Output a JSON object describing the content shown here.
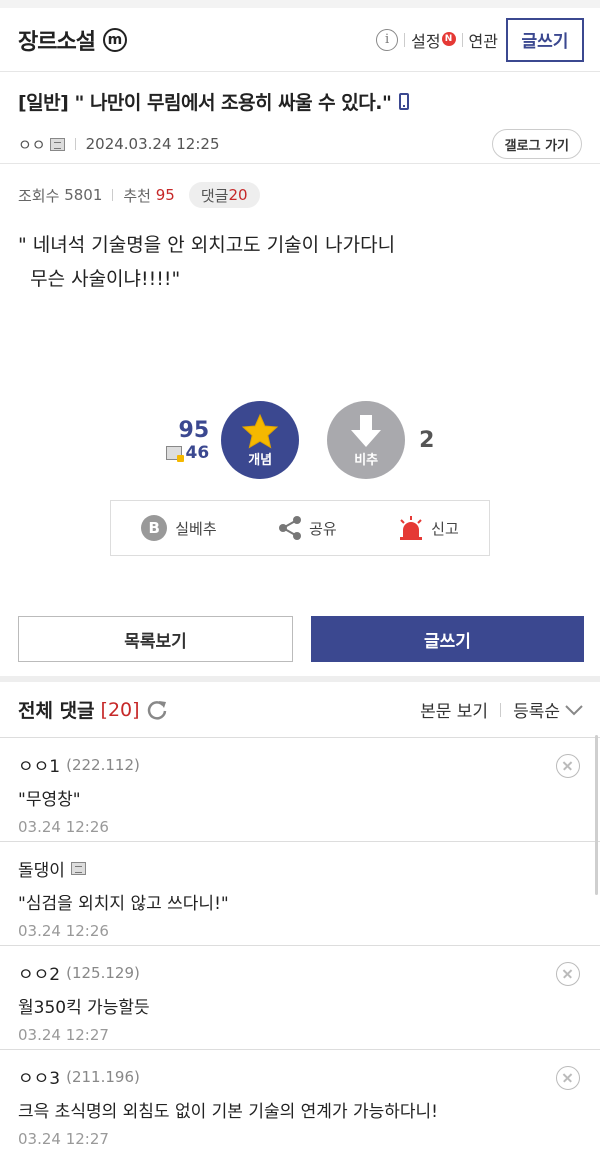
{
  "header": {
    "gallery_title": "장르소설",
    "m_badge": "m",
    "settings_label": "설정",
    "new_badge": "N",
    "related_label": "연관",
    "write_label": "글쓰기"
  },
  "post": {
    "title": "[일반] \" 나만이 무림에서 조용히 싸울 수 있다.\"",
    "author": "ㅇㅇ",
    "date": "2024.03.24 12:25",
    "gallery_go_label": "갤로그 가기",
    "views_label": "조회수",
    "views": "5801",
    "recommend_label": "추천",
    "recommend": "95",
    "reply_label": "댓글",
    "reply_count": "20",
    "body": "\" 네녀석 기술명을 안 외치고도 기술이 나가다니\n  무슨 사술이냐!!!!\""
  },
  "vote": {
    "up_count": "95",
    "fixed_up_count": "46",
    "up_label": "개념",
    "down_label": "비추",
    "down_count": "2"
  },
  "actions": {
    "silbechu_label": "실베추",
    "share_label": "공유",
    "report_label": "신고"
  },
  "buttons": {
    "list_label": "목록보기",
    "write_label": "글쓰기"
  },
  "comments_header": {
    "title": "전체 댓글",
    "count": "[20]",
    "view_body_label": "본문 보기",
    "sort_label": "등록순"
  },
  "comments": [
    {
      "nick": "ㅇㅇ1",
      "ip": "(222.112)",
      "text": "\"무영창\"",
      "date": "03.24 12:26"
    },
    {
      "nick": "돌댕이",
      "ip": "",
      "text": "\"심검을 외치지 않고 쓰다니!\"",
      "date": "03.24 12:26"
    },
    {
      "nick": "ㅇㅇ2",
      "ip": "(125.129)",
      "text": "월350킥 가능할듯",
      "date": "03.24 12:27"
    },
    {
      "nick": "ㅇㅇ3",
      "ip": "(211.196)",
      "text": "크윽 초식명의 외침도 없이 기본 기술의 연계가 가능하다니!",
      "date": "03.24 12:27"
    }
  ],
  "colors": {
    "brand": "#3b4890",
    "accent_red": "#c62828",
    "star": "#f5b800",
    "report_red": "#e53935"
  }
}
